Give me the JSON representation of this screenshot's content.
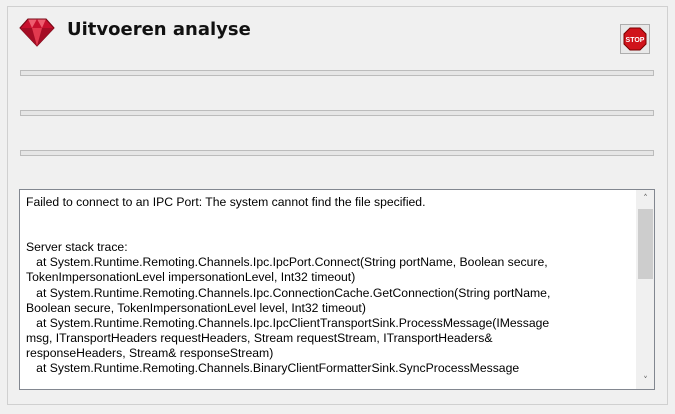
{
  "window": {
    "title": "Uitvoeren analyse"
  },
  "icons": {
    "logo": "ruby-gem-icon",
    "stop": "stop-sign-icon"
  },
  "stop_button": {
    "label": "STOP"
  },
  "progress_bars": [
    {
      "value": 0
    },
    {
      "value": 0
    },
    {
      "value": 0
    }
  ],
  "log": {
    "text": "Failed to connect to an IPC Port: The system cannot find the file specified.\n\n\nServer stack trace:\n   at System.Runtime.Remoting.Channels.Ipc.IpcPort.Connect(String portName, Boolean secure,\nTokenImpersonationLevel impersonationLevel, Int32 timeout)\n   at System.Runtime.Remoting.Channels.Ipc.ConnectionCache.GetConnection(String portName,\nBoolean secure, TokenImpersonationLevel level, Int32 timeout)\n   at System.Runtime.Remoting.Channels.Ipc.IpcClientTransportSink.ProcessMessage(IMessage\nmsg, ITransportHeaders requestHeaders, Stream requestStream, ITransportHeaders&\nresponseHeaders, Stream& responseStream)\n   at System.Runtime.Remoting.Channels.BinaryClientFormatterSink.SyncProcessMessage"
  },
  "scrollbar": {
    "up_arrow": "˄",
    "down_arrow": "˅"
  },
  "colors": {
    "stop_red": "#d0141c",
    "gem_red": "#c8102e",
    "progress_fill": "#06b025"
  }
}
